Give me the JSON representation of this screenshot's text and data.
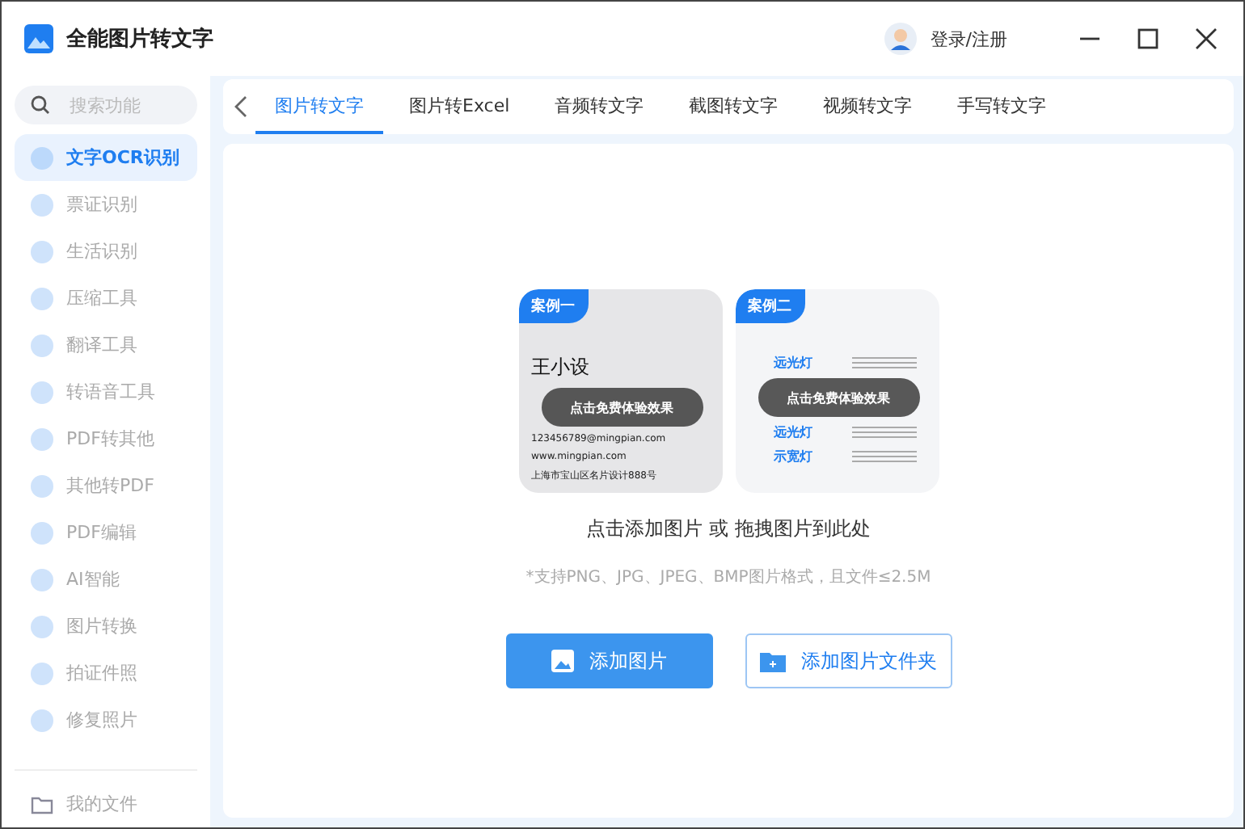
{
  "window": {
    "title": "全能图片转文字",
    "login": "登录/注册"
  },
  "search": {
    "placeholder": "搜索功能"
  },
  "sidebar": {
    "items": [
      {
        "label": "文字OCR识别",
        "selected": true
      },
      {
        "label": "票证识别",
        "selected": false
      },
      {
        "label": "生活识别",
        "selected": false
      },
      {
        "label": "压缩工具",
        "selected": false
      },
      {
        "label": "翻译工具",
        "selected": false
      },
      {
        "label": "转语音工具",
        "selected": false
      },
      {
        "label": "PDF转其他",
        "selected": false
      },
      {
        "label": "其他转PDF",
        "selected": false
      },
      {
        "label": "PDF编辑",
        "selected": false
      },
      {
        "label": "AI智能",
        "selected": false
      },
      {
        "label": "图片转换",
        "selected": false
      },
      {
        "label": "拍证件照",
        "selected": false
      },
      {
        "label": "修复照片",
        "selected": false
      }
    ],
    "footer": "我的文件"
  },
  "tabs": [
    {
      "label": "图片转文字",
      "selected": true
    },
    {
      "label": "图片转Excel",
      "selected": false
    },
    {
      "label": "音频转文字",
      "selected": false
    },
    {
      "label": "截图转文字",
      "selected": false
    },
    {
      "label": "视频转文字",
      "selected": false
    },
    {
      "label": "手写转文字",
      "selected": false
    }
  ],
  "examples": [
    {
      "badge": "案例一",
      "overlay": "点击免费体验效果",
      "kind": "card",
      "name": "王小设",
      "lines": [
        "123456789@mingpian.com",
        "www.mingpian.com",
        "上海市宝山区名片设计888号"
      ]
    },
    {
      "badge": "案例二",
      "overlay": "点击免费体验效果",
      "kind": "lights",
      "top_labels": [
        "远光灯"
      ],
      "labels": [
        "远光灯",
        "示宽灯"
      ]
    }
  ],
  "drop_hint": "点击添加图片 或 拖拽图片到此处",
  "formats": "*支持PNG、JPG、JPEG、BMP图片格式，且文件≤2.5M",
  "buttons": [
    {
      "label": "添加图片",
      "kind": "primary"
    },
    {
      "label": "添加图片文件夹",
      "kind": "outline"
    }
  ]
}
